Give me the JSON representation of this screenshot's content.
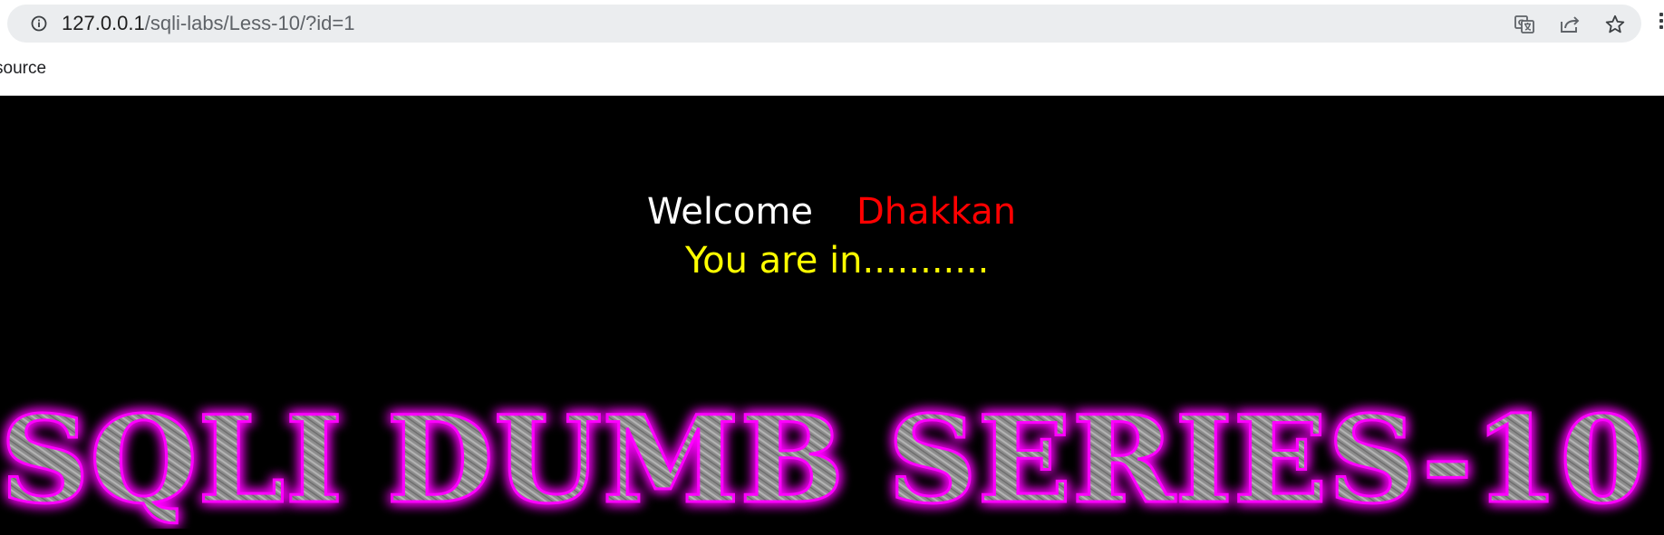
{
  "browser": {
    "url_host": "127.0.0.1",
    "url_path": "/sqli-labs/Less-10/?id=1"
  },
  "bookmarks": {
    "item": "source"
  },
  "page": {
    "welcome_label": "Welcome",
    "user_name": "Dhakkan",
    "status_message": "You are in...........",
    "banner_text": "SQLI DUMB SERIES-10"
  },
  "colors": {
    "page_background": "#000000",
    "welcome_text": "#ffffff",
    "user_name_text": "#ff0000",
    "status_text": "#ffff00",
    "banner_glow": "#ff00ff",
    "banner_fill": "#9a9a9a"
  }
}
